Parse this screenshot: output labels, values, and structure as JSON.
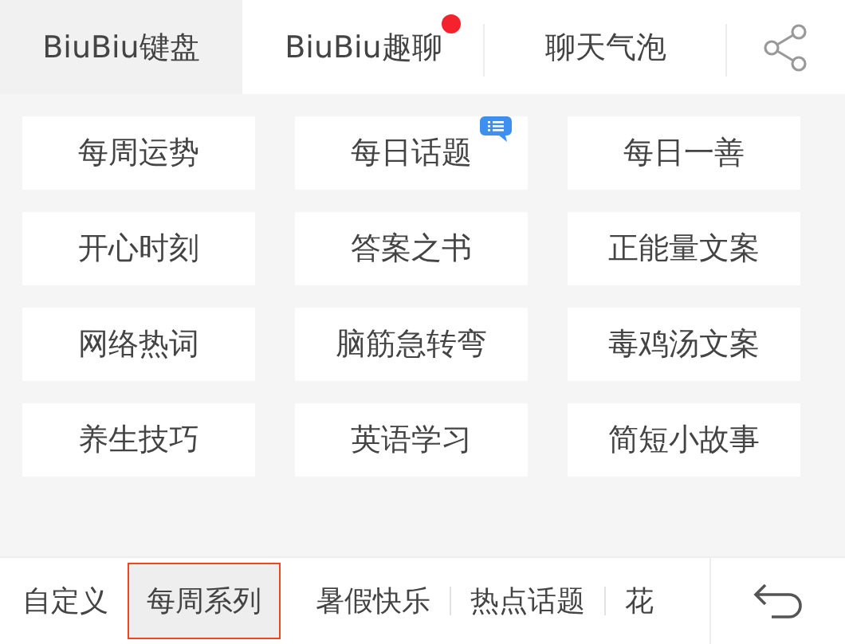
{
  "top_tabs": [
    {
      "label": "BiuBiu键盘",
      "selected": true,
      "badge": false
    },
    {
      "label": "BiuBiu趣聊",
      "selected": false,
      "badge": true
    },
    {
      "label": "聊天气泡",
      "selected": false,
      "badge": false
    }
  ],
  "items": [
    {
      "label": "每周运势",
      "badge": false
    },
    {
      "label": "每日话题",
      "badge": true
    },
    {
      "label": "每日一善",
      "badge": false
    },
    {
      "label": "开心时刻",
      "badge": false
    },
    {
      "label": "答案之书",
      "badge": false
    },
    {
      "label": "正能量文案",
      "badge": false
    },
    {
      "label": "网络热词",
      "badge": false
    },
    {
      "label": "脑筋急转弯",
      "badge": false
    },
    {
      "label": "毒鸡汤文案",
      "badge": false
    },
    {
      "label": "养生技巧",
      "badge": false
    },
    {
      "label": "英语学习",
      "badge": false
    },
    {
      "label": "简短小故事",
      "badge": false
    }
  ],
  "categories": [
    {
      "label": "自定义",
      "selected": false
    },
    {
      "label": "每周系列",
      "selected": true
    },
    {
      "label": "暑假快乐",
      "selected": false
    },
    {
      "label": "热点话题",
      "selected": false
    },
    {
      "label": "花",
      "selected": false
    }
  ]
}
